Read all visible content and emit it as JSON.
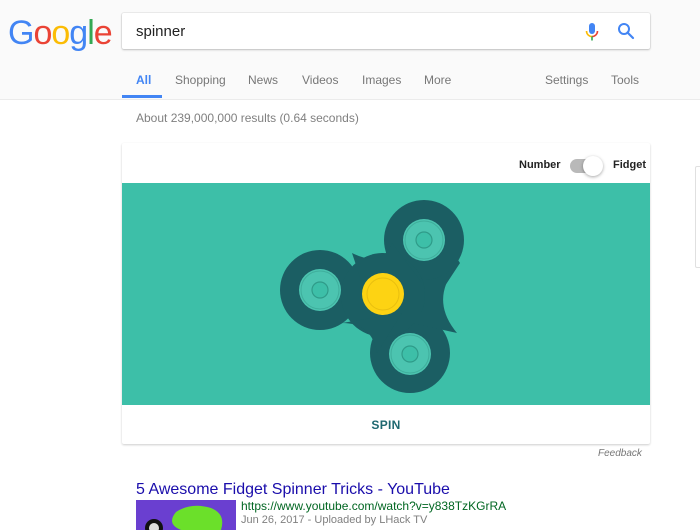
{
  "logo": {
    "letters": [
      "G",
      "o",
      "o",
      "g",
      "l",
      "e"
    ],
    "colors": [
      "#4285f4",
      "#ea4335",
      "#fbbc05",
      "#4285f4",
      "#34a853",
      "#ea4335"
    ]
  },
  "search": {
    "value": "spinner",
    "mic_icon": "microphone-icon",
    "search_icon": "magnifier-icon"
  },
  "tabs": [
    {
      "label": "All",
      "active": true
    },
    {
      "label": "Shopping"
    },
    {
      "label": "News"
    },
    {
      "label": "Videos"
    },
    {
      "label": "Images"
    },
    {
      "label": "More"
    },
    {
      "label": "Settings"
    },
    {
      "label": "Tools"
    }
  ],
  "stats": "About 239,000,000 results (0.64 seconds)",
  "spinner_widget": {
    "toggle_left_label": "Number",
    "toggle_right_label": "Fidget",
    "toggle_state": "Fidget",
    "spin_label": "SPIN",
    "colors": {
      "background": "#3dbfa8",
      "body": "#1b5e63",
      "bearing": "#4cc4b0",
      "center": "#fdd313"
    }
  },
  "feedback": "Feedback",
  "results": [
    {
      "title": "5 Awesome Fidget Spinner Tricks - YouTube",
      "url": "https://www.youtube.com/watch?v=y838TzKGrRA",
      "meta": "Jun 26, 2017 - Uploaded by LHack TV"
    }
  ]
}
